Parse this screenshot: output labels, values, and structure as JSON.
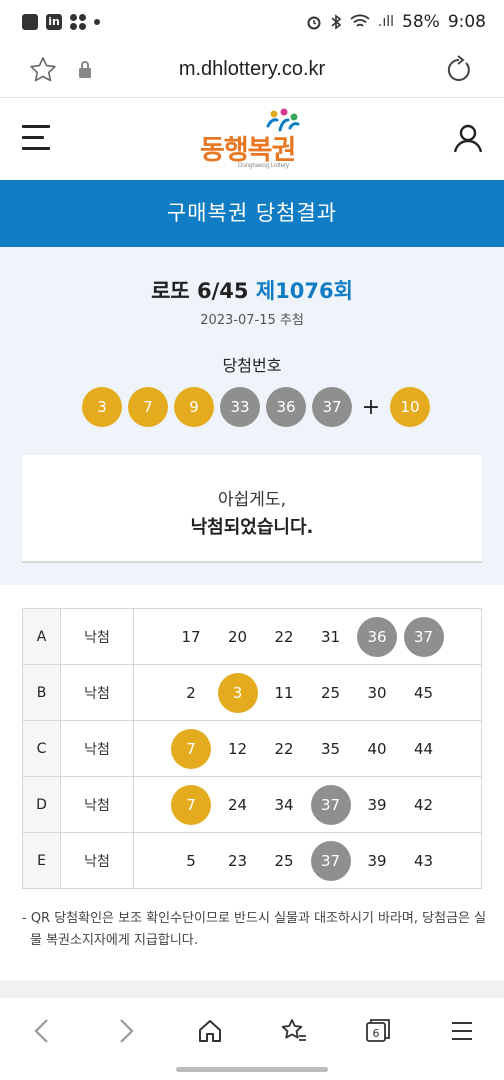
{
  "status_bar": {
    "battery": "58%",
    "time": "9:08",
    "signal": ".ıll"
  },
  "address_bar": {
    "url": "m.dhlottery.co.kr"
  },
  "header": {
    "logo_text": "동행복권",
    "logo_subtitle": "Donghaeng Lottery",
    "colors": {
      "logo_orange": "#e87722",
      "logo_blue": "#0f7cc4"
    }
  },
  "banner": {
    "title": "구매복권 당첨결과",
    "color": "#0f7cc4"
  },
  "result": {
    "game": "로또 6/45",
    "round": "제1076회",
    "date": "2023-07-15 추첨",
    "winning_label": "당첨번호",
    "winning_numbers": [
      "3",
      "7",
      "9",
      "33",
      "36",
      "37"
    ],
    "plus": "+",
    "bonus": "10",
    "message_line1": "아쉽게도,",
    "message_line2": "낙첨되었습니다."
  },
  "table": {
    "rows": [
      {
        "game": "A",
        "status": "낙첨",
        "numbers": [
          "17",
          "20",
          "22",
          "31",
          "36",
          "37"
        ]
      },
      {
        "game": "B",
        "status": "낙첨",
        "numbers": [
          "2",
          "3",
          "11",
          "25",
          "30",
          "45"
        ]
      },
      {
        "game": "C",
        "status": "낙첨",
        "numbers": [
          "7",
          "12",
          "22",
          "35",
          "40",
          "44"
        ]
      },
      {
        "game": "D",
        "status": "낙첨",
        "numbers": [
          "7",
          "24",
          "34",
          "37",
          "39",
          "42"
        ]
      },
      {
        "game": "E",
        "status": "낙첨",
        "numbers": [
          "5",
          "23",
          "25",
          "37",
          "39",
          "43"
        ]
      }
    ]
  },
  "note": "- QR 당첨확인은 보조 확인수단이므로 반드시 실물과 대조하시기 바라며, 당첨금은 실물 복권소지자에게 지급합니다.",
  "bottom_nav": {
    "tabs_count": "6",
    "items": [
      "back-icon",
      "forward-icon",
      "home-icon",
      "bookmarks-icon",
      "tabs-icon",
      "menu-icon"
    ]
  },
  "ball_colors": {
    "yellow": "#e4ab1e",
    "gray": "#8f8f8f"
  }
}
